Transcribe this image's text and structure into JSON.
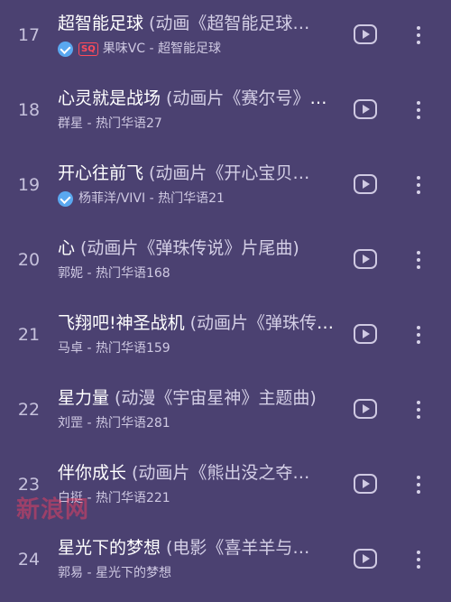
{
  "colors": {
    "background": "#4b4171",
    "verified_badge": "#5aa8f0",
    "sq_badge": "#ff4a5a"
  },
  "icons": {
    "verified": "verified-check-icon",
    "sq": "sq-quality-badge",
    "play": "play-icon",
    "more": "more-vertical-icon"
  },
  "watermark": "新浪网",
  "songs": [
    {
      "index": "17",
      "title": "超智能足球",
      "subtitle": "(动画《超智能足球…",
      "artist": "果味VC - 超智能足球",
      "verified": true,
      "sq": true
    },
    {
      "index": "18",
      "title": "心灵就是战场",
      "subtitle": "(动画片《赛尔号》主题曲)",
      "artist": "群星 - 热门华语27",
      "verified": false,
      "sq": false
    },
    {
      "index": "19",
      "title": "开心往前飞",
      "subtitle": "(动画片《开心宝贝…",
      "artist": "杨菲洋/VIVI - 热门华语21",
      "verified": true,
      "sq": false
    },
    {
      "index": "20",
      "title": "心",
      "subtitle": "(动画片《弹珠传说》片尾曲)",
      "artist": "郭妮 - 热门华语168",
      "verified": false,
      "sq": false
    },
    {
      "index": "21",
      "title": "飞翔吧!神圣战机",
      "subtitle": "(动画片《弹珠传说》…",
      "artist": "马卓 - 热门华语159",
      "verified": false,
      "sq": false
    },
    {
      "index": "22",
      "title": "星力量",
      "subtitle": "(动漫《宇宙星神》主题曲)",
      "artist": "刘罡 - 热门华语281",
      "verified": false,
      "sq": false
    },
    {
      "index": "23",
      "title": "伴你成长",
      "subtitle": "(动画片《熊出没之夺…",
      "artist": "白挺 - 热门华语221",
      "verified": false,
      "sq": false
    },
    {
      "index": "24",
      "title": "星光下的梦想",
      "subtitle": "(电影《喜羊羊与…",
      "artist": "郭易 - 星光下的梦想",
      "verified": false,
      "sq": false
    }
  ]
}
